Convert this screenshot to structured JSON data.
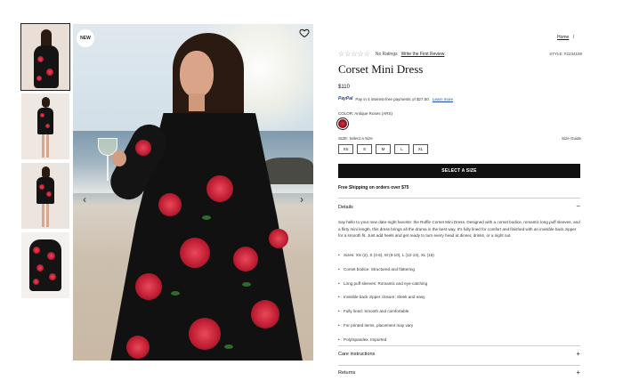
{
  "badge": {
    "new_label": "NEW"
  },
  "breadcrumb": {
    "home": "Home",
    "separator": "/"
  },
  "product": {
    "rating_text": "No Ratings",
    "write_review": "Write the First Review",
    "style_number": "STYLE: #2234189",
    "title": "Corset Mini Dress",
    "price": "$110",
    "paypal": {
      "brand": "PayPal",
      "text": "Pay in 4 interest-free payments of $27.50.",
      "learn_more": "Learn more"
    },
    "color_label": "COLOR:",
    "color_value": "Antique Roses (ARS)",
    "size_label": "SIZE:",
    "size_value": "Select a Size",
    "size_guide": "Size Guide",
    "sizes": [
      "XS",
      "S",
      "M",
      "L",
      "XL"
    ],
    "select_button": "SELECT A SIZE",
    "shipping": "Free Shipping on orders over $75"
  },
  "details": {
    "title": "Details",
    "icon": "minus-icon",
    "description": "Say hello to your new date-night favorite: the Ruffle Corset Mini Dress. Designed with a corset bodice, romantic long puff sleeves, and a flirty mini length, this dress brings all the drama in the best way. It's fully lined for comfort and finished with an invisible back zipper for a smooth fit. Just add heels and get ready to turn every head at dinner, drinks, or a night out.",
    "bullets": [
      "Sizes: XS (2), S (4-6), M (8-10), L (12-14), XL (16)",
      "Corset bodice: Structured and flattering",
      "Long puff sleeves: Romantic and eye-catching",
      "Invisible back zipper closure: Sleek and easy",
      "Fully lined: Smooth and comfortable",
      "For printed items, placement may vary",
      "Poly/spandex. Imported"
    ]
  },
  "care": {
    "title": "Care instructions",
    "icon": "plus-icon"
  },
  "returns": {
    "title": "Returns",
    "icon": "plus-icon"
  },
  "colors": {
    "accent": "#111111",
    "swatch": "#8a1020"
  }
}
